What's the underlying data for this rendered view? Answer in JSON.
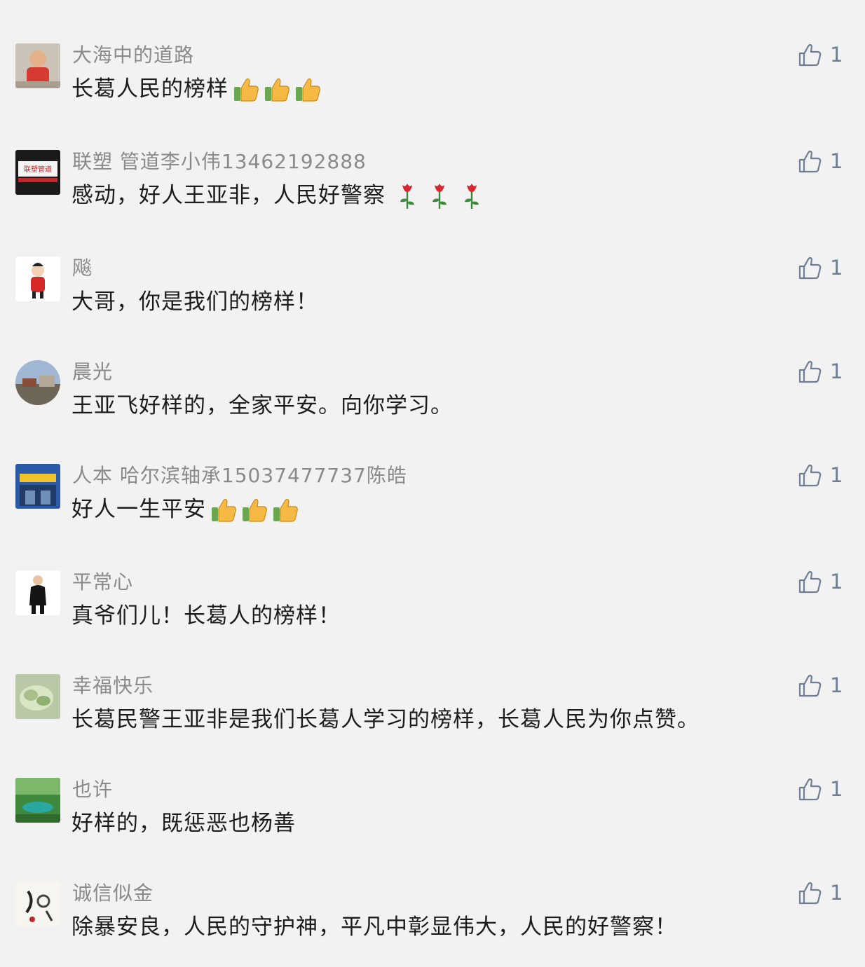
{
  "comments": [
    {
      "nickname": "大海中的道路",
      "text": "长葛人民的榜样",
      "emoji": "thumbs-up",
      "emoji_count": 3,
      "likes": "1"
    },
    {
      "nickname": "联塑 管道李小伟13462192888",
      "text": "感动，好人王亚非，人民好警察",
      "emoji": "rose",
      "emoji_count": 3,
      "likes": "1",
      "avatar_text": "联塑管道"
    },
    {
      "nickname": "飚",
      "text": "大哥，你是我们的榜样！",
      "likes": "1"
    },
    {
      "nickname": "晨光",
      "text": "王亚飞好样的，全家平安。向你学习。",
      "likes": "1"
    },
    {
      "nickname": "人本 哈尔滨轴承15037477737陈皓",
      "text": "好人一生平安",
      "emoji": "thumbs-up",
      "emoji_count": 3,
      "likes": "1"
    },
    {
      "nickname": "平常心",
      "text": "真爷们儿！长葛人的榜样！",
      "likes": "1"
    },
    {
      "nickname": "幸福快乐",
      "text": "长葛民警王亚非是我们长葛人学习的榜样，长葛人民为你点赞。",
      "likes": "1"
    },
    {
      "nickname": "也许",
      "text": "好样的，既惩恶也杨善",
      "likes": "1"
    },
    {
      "nickname": "诚信似金",
      "text": "除暴安良，人民的守护神，平凡中彰显伟大，人民的好警察！",
      "likes": "1"
    }
  ],
  "icons": {
    "like": "thumbs-up-outline-icon",
    "emoji_thumb": "thumbs-up-emoji",
    "emoji_rose": "rose-emoji"
  },
  "colors": {
    "background": "#f2f2f2",
    "nickname": "#8a8a8a",
    "text": "#1c1c1c",
    "like": "#6e7c94"
  }
}
